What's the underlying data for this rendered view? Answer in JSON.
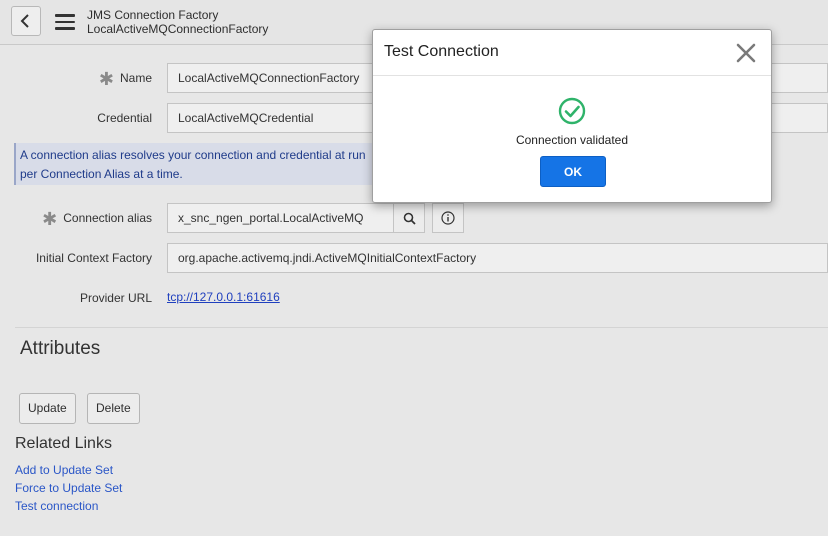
{
  "header": {
    "title": "JMS Connection Factory",
    "subtitle": "LocalActiveMQConnectionFactory"
  },
  "form": {
    "name": {
      "label": "Name",
      "value": "LocalActiveMQConnectionFactory"
    },
    "credential": {
      "label": "Credential",
      "value": "LocalActiveMQCredential"
    },
    "info_line1": "A connection alias resolves your connection and credential at run",
    "info_line2": "per Connection Alias at a time.",
    "connection_alias": {
      "label": "Connection alias",
      "value": "x_snc_ngen_portal.LocalActiveMQ"
    },
    "initial_context_factory": {
      "label": "Initial Context Factory",
      "value": "org.apache.activemq.jndi.ActiveMQInitialContextFactory"
    },
    "provider_url": {
      "label": "Provider URL",
      "value": "tcp://127.0.0.1:61616"
    }
  },
  "attributes": {
    "title": "Attributes"
  },
  "actions": {
    "update_label": "Update",
    "delete_label": "Delete"
  },
  "related_links": {
    "title": "Related Links",
    "items": [
      "Add to Update Set",
      "Force to Update Set",
      "Test connection"
    ]
  },
  "modal": {
    "title": "Test Connection",
    "message": "Connection validated",
    "ok_label": "OK"
  },
  "colors": {
    "accent": "#1574e6",
    "success": "#2fb36a",
    "info_bg": "#d8dce8"
  },
  "icons": [
    "back-icon",
    "menu-icon",
    "search-icon",
    "info-icon",
    "close-icon",
    "check-circle-icon"
  ]
}
